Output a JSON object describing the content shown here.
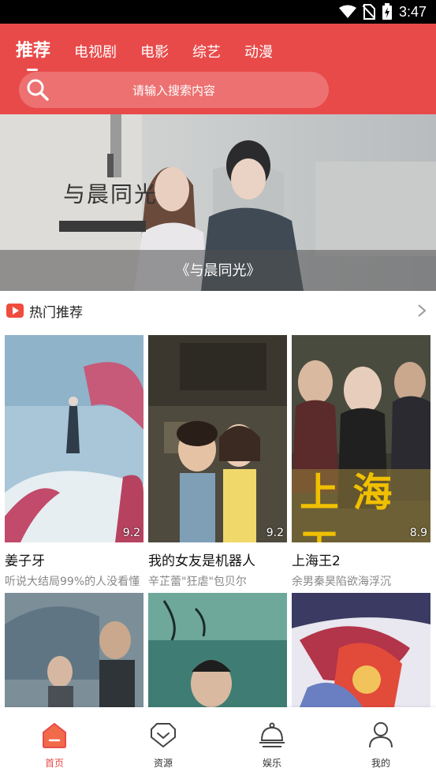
{
  "status": {
    "time": "3:47"
  },
  "tabs": [
    {
      "label": "推荐",
      "active": true
    },
    {
      "label": "电视剧"
    },
    {
      "label": "电影"
    },
    {
      "label": "综艺"
    },
    {
      "label": "动漫"
    }
  ],
  "search": {
    "placeholder": "请输入搜索内容"
  },
  "banner": {
    "caption": "《与晨同光》",
    "poster_text": "与晨同光"
  },
  "section": {
    "title": "热门推荐"
  },
  "cards": [
    {
      "title": "姜子牙",
      "subtitle": "听说大结局99%的人没看懂",
      "score": "9.2"
    },
    {
      "title": "我的女友是机器人",
      "subtitle": "辛芷蕾\"狂虐\"包贝尔",
      "score": "9.2"
    },
    {
      "title": "上海王2",
      "subtitle": "余男秦昊陷欲海浮沉",
      "score": "8.9"
    }
  ],
  "bottom_nav": [
    {
      "label": "首页",
      "icon": "home-icon",
      "active": true
    },
    {
      "label": "资源",
      "icon": "resource-icon"
    },
    {
      "label": "娱乐",
      "icon": "entertainment-bell-icon"
    },
    {
      "label": "我的",
      "icon": "profile-icon"
    }
  ],
  "colors": {
    "accent": "#e84a4a",
    "section_icon": "#f04c3e"
  }
}
